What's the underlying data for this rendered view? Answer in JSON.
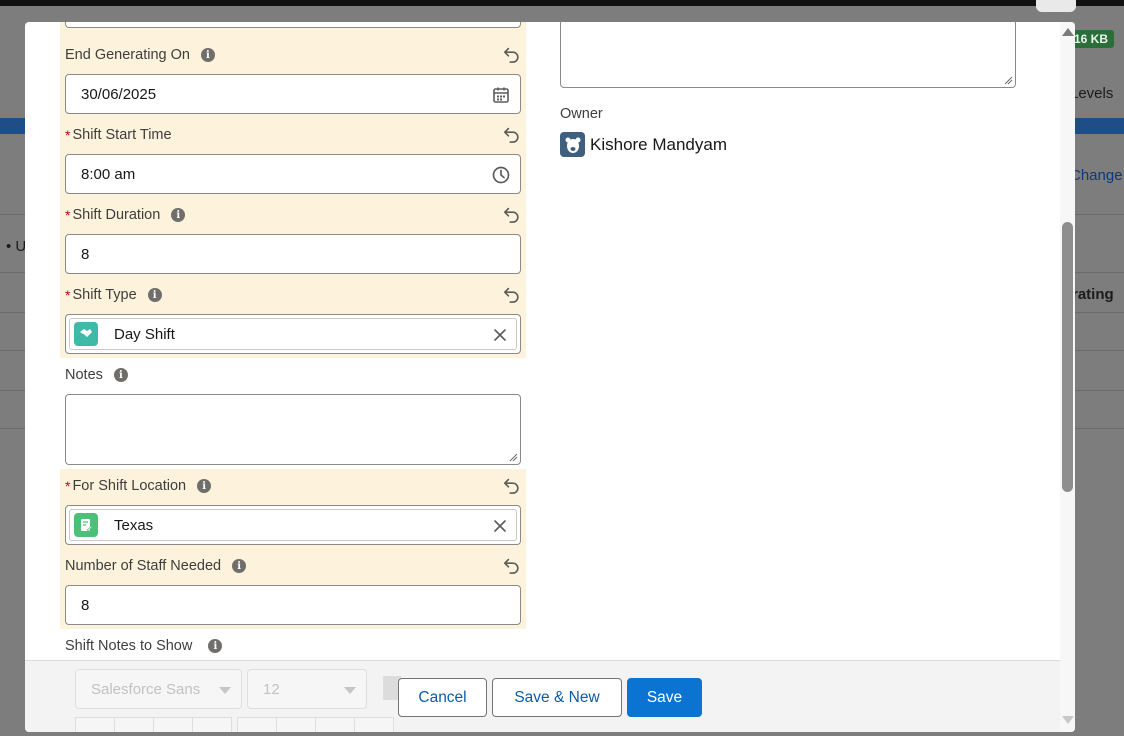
{
  "background": {
    "badge": "16 KB",
    "levels_text": "Levels",
    "change_link": "Change",
    "bullet_text": "• U",
    "generating_text": "rating"
  },
  "form": {
    "end_generating_on": {
      "label": "End Generating On",
      "value": "30/06/2025"
    },
    "shift_start_time": {
      "label": "Shift Start Time",
      "value": "8:00 am",
      "required": "*"
    },
    "shift_duration": {
      "label": "Shift Duration",
      "value": "8",
      "required": "*"
    },
    "shift_type": {
      "label": "Shift Type",
      "value": "Day Shift",
      "required": "*"
    },
    "notes": {
      "label": "Notes",
      "value": ""
    },
    "for_shift_location": {
      "label": "For Shift Location",
      "value": "Texas",
      "required": "*"
    },
    "number_of_staff_needed": {
      "label": "Number of Staff Needed",
      "value": "8"
    },
    "shift_notes_to_show": {
      "label": "Shift Notes to Show"
    },
    "owner": {
      "label": "Owner",
      "value": "Kishore Mandyam"
    }
  },
  "rich_text_toolbar": {
    "font_family": "Salesforce Sans",
    "font_size": "12"
  },
  "footer": {
    "cancel_label": "Cancel",
    "save_new_label": "Save & New",
    "save_label": "Save"
  },
  "colors": {
    "highlight": "#fdf2dc",
    "brand": "#0b74d2",
    "link": "#0b5cab",
    "required": "#ba0517",
    "shift_type_icon": "#3fb9a8",
    "location_icon": "#4bc076"
  }
}
